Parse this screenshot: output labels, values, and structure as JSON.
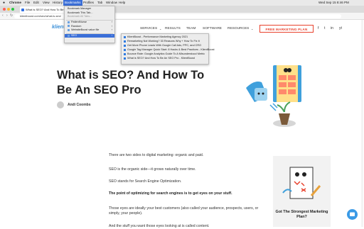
{
  "menubar": {
    "apple": "",
    "app": "Chrome",
    "items": [
      "File",
      "Edit",
      "View",
      "History",
      "Bookmarks",
      "Profiles",
      "Tab",
      "Window",
      "Help"
    ],
    "active": "Bookmarks",
    "clock": "Wed Sep 15  8:46 PM"
  },
  "browser": {
    "tab_title": "What is SEO? And How To Be",
    "address": "klientboost.com/seo/what-is-seo/"
  },
  "bookmarks_menu": {
    "items": [
      {
        "label": "Bookmark Manager",
        "state": "normal"
      },
      {
        "label": "Bookmark This Tab...",
        "state": "normal"
      },
      {
        "label": "Bookmark All Tabs...",
        "state": "disabled"
      },
      {
        "label": "PatientNurse",
        "state": "folder"
      },
      {
        "label": "Random",
        "state": "folder"
      },
      {
        "label": "WebsiteBoost value file",
        "state": "folder"
      },
      {
        "label": "SEO",
        "state": "highlighted"
      }
    ],
    "submenu": [
      "KlientBoost - Performance Marketing Agency 2021",
      "Remarketing Not Working? 33 Reasons Why + How To Fix It",
      "Get More Phone Leads With Google Call Ads, PPC, and CRO",
      "Google Tag Manager Quick Start: 8 Hacks & Best Practices - KlientBoost",
      "Bounce Rate: Google Analytics Guide To A Misunderstood Metric",
      "What is SEO? And How To Be An SEO Pro - KlientBoost"
    ]
  },
  "site": {
    "logo": "klient",
    "nav": [
      "SERVICES",
      "RESULTS",
      "TEAM",
      "SOFTWARE",
      "RESOURCES"
    ],
    "cta": "FREE MARKETING PLAN"
  },
  "article": {
    "title": "What is SEO? And How To Be An SEO Pro",
    "author": "Andi Coombs",
    "paragraphs": [
      "There are two sides to digital marketing: organic and paid.",
      "SEO is the organic side—it grows naturally over time.",
      "SEO stands for Search Engine Optimization.",
      "The point of optimizing for search engines is to get eyes on your stuff.",
      "Those eyes are ideally your best customers (also called your audience, prospects, users, or simply, your people).",
      "And the stuff you want those eyes looking at is called content."
    ]
  },
  "sidebar": {
    "card_title": "Got The Strongest Marketing Plan?"
  },
  "colors": {
    "accent": "#e8412c",
    "brand": "#3a8fd8",
    "menu_highlight": "#3b6fd8"
  }
}
